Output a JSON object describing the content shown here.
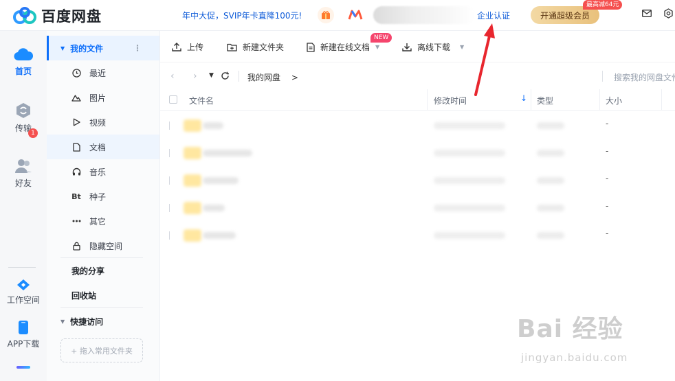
{
  "header": {
    "app_name": "百度网盘",
    "promo_text": "年中大促，SVIP年卡直降100元!",
    "enterprise_auth": "企业认证",
    "vip_button": "开通超级会员",
    "vip_badge": "最高减64元",
    "icons": [
      "gift-icon",
      "app-logo-icon",
      "mail-icon",
      "gear-icon"
    ]
  },
  "rail": {
    "items": [
      {
        "label": "首页",
        "icon": "cloud-icon",
        "active": true
      },
      {
        "label": "传输",
        "icon": "transfer-icon",
        "badge": "1"
      },
      {
        "label": "好友",
        "icon": "friends-icon"
      },
      {
        "label": "工作空间",
        "icon": "workspace-icon"
      },
      {
        "label": "APP下载",
        "icon": "phone-icon"
      }
    ]
  },
  "sidebar": {
    "my_files": "我的文件",
    "categories": [
      {
        "label": "最近",
        "icon": "clock-icon"
      },
      {
        "label": "图片",
        "icon": "image-icon"
      },
      {
        "label": "视频",
        "icon": "play-icon"
      },
      {
        "label": "文档",
        "icon": "document-icon",
        "selected": true
      },
      {
        "label": "音乐",
        "icon": "headphones-icon"
      },
      {
        "label": "种子",
        "icon": "bt-icon",
        "glyph": "Bt"
      },
      {
        "label": "其它",
        "icon": "more-icon"
      },
      {
        "label": "隐藏空间",
        "icon": "lock-icon"
      }
    ],
    "my_share": "我的分享",
    "recycle": "回收站",
    "quick_access": "快捷访问",
    "drop_hint": "+ 拖入常用文件夹"
  },
  "toolbar": {
    "upload": "上传",
    "new_folder": "新建文件夹",
    "new_doc": "新建在线文档",
    "new_badge": "NEW",
    "offline_download": "离线下载"
  },
  "navbar": {
    "path": "我的网盘",
    "path_sep": ">",
    "search_placeholder": "搜索我的网盘文件"
  },
  "table": {
    "columns": [
      "文件名",
      "修改时间",
      "类型",
      "大小"
    ],
    "sort_arrow": "↓",
    "rows": [
      {
        "size": "-"
      },
      {
        "size": "-"
      },
      {
        "size": "-"
      },
      {
        "size": "-"
      },
      {
        "size": "-"
      }
    ]
  },
  "watermark": {
    "main": "Bai 经验",
    "sub": "jingyan.baidu.com"
  },
  "colors": {
    "accent": "#0e6ffa",
    "promo": "#0e5bd8",
    "vip_gold": "#e9c17c",
    "badge_red": "#f5504f",
    "annotation_red": "#e8262e"
  }
}
